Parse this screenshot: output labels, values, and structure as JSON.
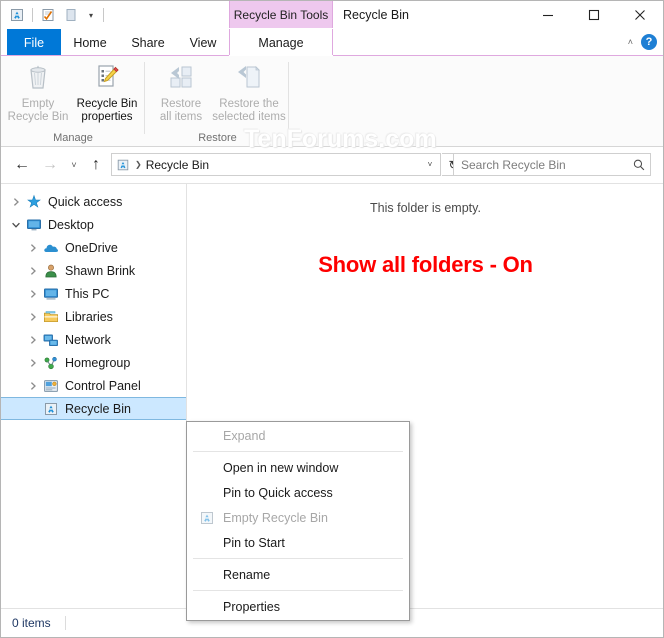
{
  "window": {
    "title": "Recycle Bin",
    "contextual_tab_title": "Recycle Bin Tools",
    "minimize_label": "—",
    "maximize_label": "□",
    "close_label": "✕",
    "collapse_ribbon_label": "˄",
    "help_label": "?"
  },
  "quick_access_toolbar": {
    "items": [
      {
        "name": "recycle-bin-icon",
        "label": "Recycle Bin"
      },
      {
        "name": "properties-icon",
        "label": "Properties"
      },
      {
        "name": "new-folder-icon",
        "label": "New folder"
      }
    ],
    "customize_caret": "▾"
  },
  "ribbon": {
    "tabs": [
      {
        "id": "file",
        "label": "File"
      },
      {
        "id": "home",
        "label": "Home"
      },
      {
        "id": "share",
        "label": "Share"
      },
      {
        "id": "view",
        "label": "View"
      },
      {
        "id": "manage",
        "label": "Manage"
      }
    ],
    "active_tab": "Manage",
    "groups": [
      {
        "label": "Manage",
        "buttons": [
          {
            "label_line1": "Empty",
            "label_line2": "Recycle Bin",
            "enabled": false,
            "icon": "recycle-bin-icon"
          },
          {
            "label_line1": "Recycle Bin",
            "label_line2": "properties",
            "enabled": true,
            "icon": "properties-icon"
          }
        ]
      },
      {
        "label": "Restore",
        "buttons": [
          {
            "label_line1": "Restore",
            "label_line2": "all items",
            "enabled": false,
            "icon": "restore-all-icon"
          },
          {
            "label_line1": "Restore the",
            "label_line2": "selected items",
            "enabled": false,
            "icon": "restore-selected-icon"
          }
        ]
      }
    ]
  },
  "watermark": "TenForums.com",
  "navigation": {
    "back_label": "←",
    "forward_label": "→",
    "recent_label": "˅",
    "up_label": "↑",
    "refresh_label": "↻",
    "address": {
      "crumb": "Recycle Bin",
      "chevron": "❯",
      "dropdown": "˅"
    },
    "search": {
      "placeholder": "Search Recycle Bin",
      "value": ""
    }
  },
  "tree": {
    "items": [
      {
        "label": "Quick access",
        "indent": 0,
        "twisty": "collapsed",
        "icon": "star-icon",
        "selected": false
      },
      {
        "label": "Desktop",
        "indent": 0,
        "twisty": "expanded",
        "icon": "desktop-icon",
        "selected": false
      },
      {
        "label": "OneDrive",
        "indent": 1,
        "twisty": "collapsed",
        "icon": "onedrive-icon",
        "selected": false
      },
      {
        "label": "Shawn Brink",
        "indent": 1,
        "twisty": "collapsed",
        "icon": "user-icon",
        "selected": false
      },
      {
        "label": "This PC",
        "indent": 1,
        "twisty": "collapsed",
        "icon": "this-pc-icon",
        "selected": false
      },
      {
        "label": "Libraries",
        "indent": 1,
        "twisty": "collapsed",
        "icon": "libraries-icon",
        "selected": false
      },
      {
        "label": "Network",
        "indent": 1,
        "twisty": "collapsed",
        "icon": "network-icon",
        "selected": false
      },
      {
        "label": "Homegroup",
        "indent": 1,
        "twisty": "collapsed",
        "icon": "homegroup-icon",
        "selected": false
      },
      {
        "label": "Control Panel",
        "indent": 1,
        "twisty": "collapsed",
        "icon": "control-panel-icon",
        "selected": false
      },
      {
        "label": "Recycle Bin",
        "indent": 1,
        "twisty": "none",
        "icon": "recycle-bin-icon",
        "selected": true
      }
    ]
  },
  "content": {
    "empty_message": "This folder is empty.",
    "annotation": "Show all folders - On",
    "annotation_color": "#fe0000"
  },
  "context_menu": {
    "items": [
      {
        "label": "Expand",
        "enabled": false,
        "icon": null,
        "separator_after": true
      },
      {
        "label": "Open in new window",
        "enabled": true,
        "icon": null,
        "separator_after": false
      },
      {
        "label": "Pin to Quick access",
        "enabled": true,
        "icon": null,
        "separator_after": false
      },
      {
        "label": "Empty Recycle Bin",
        "enabled": false,
        "icon": "recycle-bin-icon",
        "separator_after": false
      },
      {
        "label": "Pin to Start",
        "enabled": true,
        "icon": null,
        "separator_after": true
      },
      {
        "label": "Rename",
        "enabled": true,
        "icon": null,
        "separator_after": true
      },
      {
        "label": "Properties",
        "enabled": true,
        "icon": null,
        "separator_after": false
      }
    ]
  },
  "statusbar": {
    "item_count": "0 items"
  },
  "colors": {
    "file_tab": "#0078d7",
    "contextual_tab": "#eec8ee",
    "selection": "#cce8ff",
    "status_text": "#1f3864",
    "annotation": "#fe0000"
  }
}
